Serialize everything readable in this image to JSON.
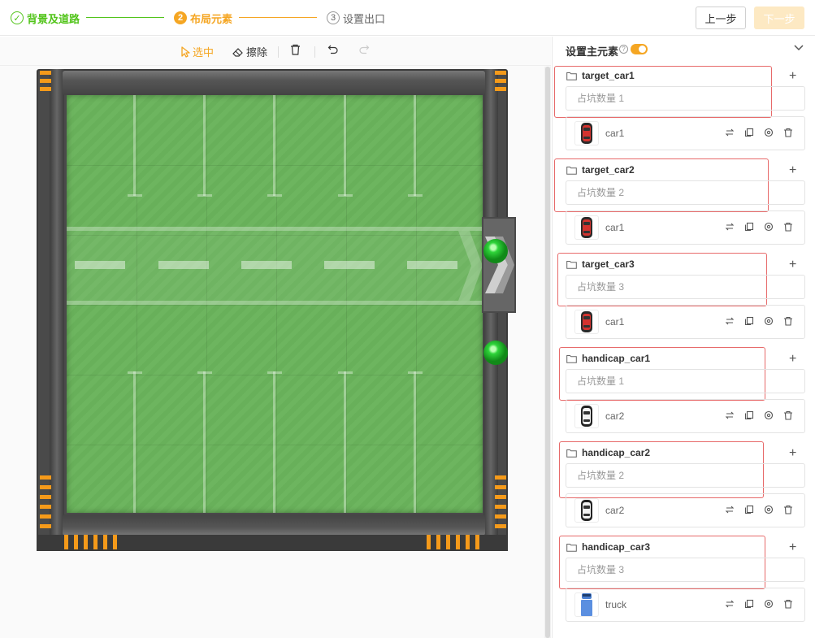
{
  "stepper": {
    "step1_label": "背景及道路",
    "step2_num": "2",
    "step2_label": "布局元素",
    "step3_num": "3",
    "step3_label": "设置出口",
    "prev_label": "上一步",
    "next_label": "下一步"
  },
  "toolbar": {
    "select_label": "选中",
    "erase_label": "擦除",
    "icons": [
      "pointer-icon",
      "eraser-icon",
      "trash-icon",
      "undo-icon",
      "redo-icon"
    ]
  },
  "panel": {
    "title": "设置主元素",
    "help_icon": "question-circle-icon",
    "toggle_on": true,
    "groups": [
      {
        "name": "target_car1",
        "count": "占坑数量 1",
        "item": "car1",
        "thumb": "red-car"
      },
      {
        "name": "target_car2",
        "count": "占坑数量 2",
        "item": "car1",
        "thumb": "red-car"
      },
      {
        "name": "target_car3",
        "count": "占坑数量 3",
        "item": "car1",
        "thumb": "red-car"
      },
      {
        "name": "handicap_car1",
        "count": "占坑数量 1",
        "item": "car2",
        "thumb": "white-car"
      },
      {
        "name": "handicap_car2",
        "count": "占坑数量 2",
        "item": "car2",
        "thumb": "white-car"
      },
      {
        "name": "handicap_car3",
        "count": "占坑数量 3",
        "item": "truck",
        "thumb": "blue-truck"
      }
    ]
  },
  "colors": {
    "accent": "#f5a623",
    "done": "#52c41a",
    "highlight": "#e76a6a",
    "grass": "#6cb45e"
  }
}
